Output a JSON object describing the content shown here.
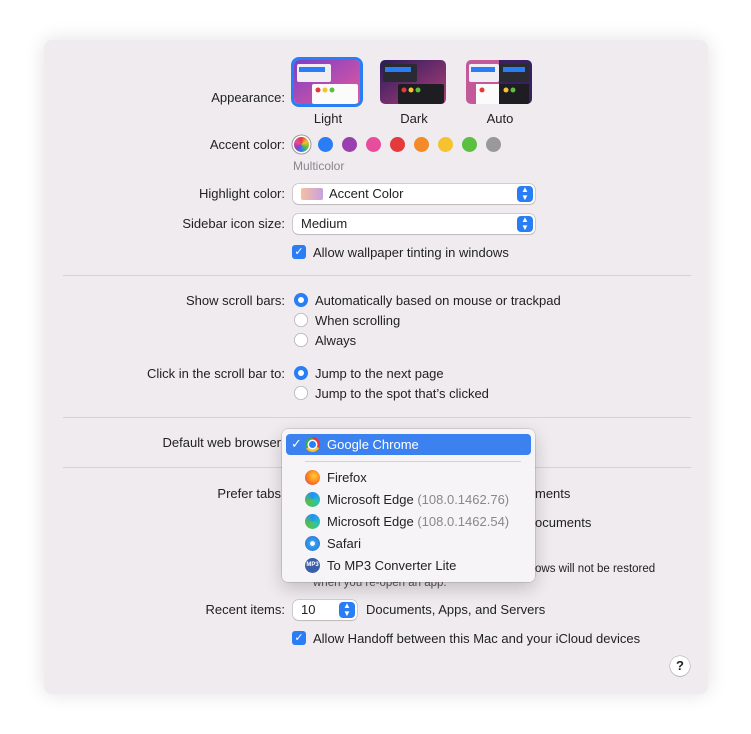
{
  "appearance": {
    "label": "Appearance:",
    "options": [
      {
        "caption": "Light",
        "selected": true
      },
      {
        "caption": "Dark",
        "selected": false
      },
      {
        "caption": "Auto",
        "selected": false
      }
    ]
  },
  "accent": {
    "label": "Accent color:",
    "selected_name": "Multicolor",
    "colors": [
      "multicolor",
      "#2a7ef5",
      "#9a3fb0",
      "#e84c9c",
      "#e6393c",
      "#f48a28",
      "#f6c22e",
      "#5bbf3f",
      "#999999"
    ]
  },
  "highlight": {
    "label": "Highlight color:",
    "value": "Accent Color"
  },
  "sidebar_icon": {
    "label": "Sidebar icon size:",
    "value": "Medium"
  },
  "wallpaper_tinting": {
    "label": "Allow wallpaper tinting in windows",
    "checked": true
  },
  "scroll_bars": {
    "label": "Show scroll bars:",
    "options": [
      "Automatically based on mouse or trackpad",
      "When scrolling",
      "Always"
    ],
    "selected": 0
  },
  "click_scroll": {
    "label": "Click in the scroll bar to:",
    "options": [
      "Jump to the next page",
      "Jump to the spot that’s clicked"
    ],
    "selected": 0
  },
  "default_browser": {
    "label": "Default web browser",
    "menu": [
      {
        "name": "Google Chrome",
        "version": "",
        "selected": true,
        "icon": "chrome-icon"
      },
      {
        "name": "Firefox",
        "version": "",
        "selected": false,
        "icon": "firefox-icon"
      },
      {
        "name": "Microsoft Edge",
        "version": "(108.0.1462.76)",
        "selected": false,
        "icon": "edge-icon"
      },
      {
        "name": "Microsoft Edge",
        "version": "(108.0.1462.54)",
        "selected": false,
        "icon": "edge-icon"
      },
      {
        "name": "Safari",
        "version": "",
        "selected": false,
        "icon": "safari-icon"
      },
      {
        "name": "To MP3 Converter Lite",
        "version": "",
        "selected": false,
        "icon": "mp3-icon"
      }
    ]
  },
  "prefer_tabs": {
    "label": "Prefer tabs",
    "partial_value": "ments"
  },
  "partial_lines": {
    "documents": "ocuments",
    "windows_restore": "ows will not be restored",
    "reopen": "when you re-open an app."
  },
  "recent_items": {
    "label": "Recent items:",
    "value": "10",
    "suffix": "Documents, Apps, and Servers"
  },
  "handoff": {
    "label": "Allow Handoff between this Mac and your iCloud devices",
    "checked": true
  },
  "help": {
    "label": "?"
  }
}
